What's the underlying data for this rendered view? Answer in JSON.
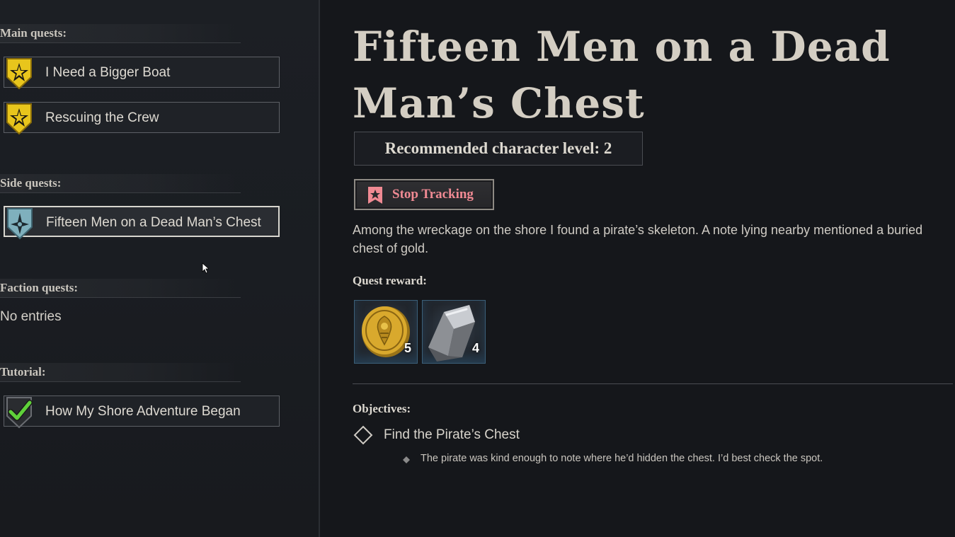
{
  "sections": {
    "main": "Main quests:",
    "side": "Side quests:",
    "faction": "Faction quests:",
    "tutorial": "Tutorial:"
  },
  "main_quests": [
    {
      "label": "I Need a Bigger Boat",
      "icon": "gold-star-shield-icon"
    },
    {
      "label": "Rescuing the Crew",
      "icon": "gold-star-shield-icon"
    }
  ],
  "side_quests": [
    {
      "label": "Fifteen Men on a Dead Man’s Chest",
      "icon": "blue-compass-shield-icon",
      "selected": true
    }
  ],
  "faction_quests": {
    "empty_text": "No entries"
  },
  "tutorial_quests": [
    {
      "label": "How My Shore Adventure Began",
      "icon": "green-checkmark-icon"
    }
  ],
  "detail": {
    "title_line1": "Fifteen Men on a Dead",
    "title_line2": "Man’s Chest",
    "level_text": "Recommended character level: 2",
    "stop_tracking": "Stop Tracking",
    "description": "Among the wreckage on the shore I found a pirate’s skeleton. A note lying nearby mentioned a buried chest of gold.",
    "reward_title": "Quest reward:",
    "rewards": [
      {
        "icon": "gold-coin-icon",
        "count": "5"
      },
      {
        "icon": "iron-ingot-icon",
        "count": "4"
      }
    ],
    "objectives_title": "Objectives:",
    "objective": "Find the Pirate’s Chest",
    "objective_hint": "The pirate was kind enough to note where he’d hidden the chest. I’d best check the spot."
  },
  "colors": {
    "tracking_accent": "#f08a93",
    "main_quest_icon": "#e8c51c",
    "side_quest_icon": "#7fb0bd",
    "tutorial_check": "#5fd13a"
  }
}
